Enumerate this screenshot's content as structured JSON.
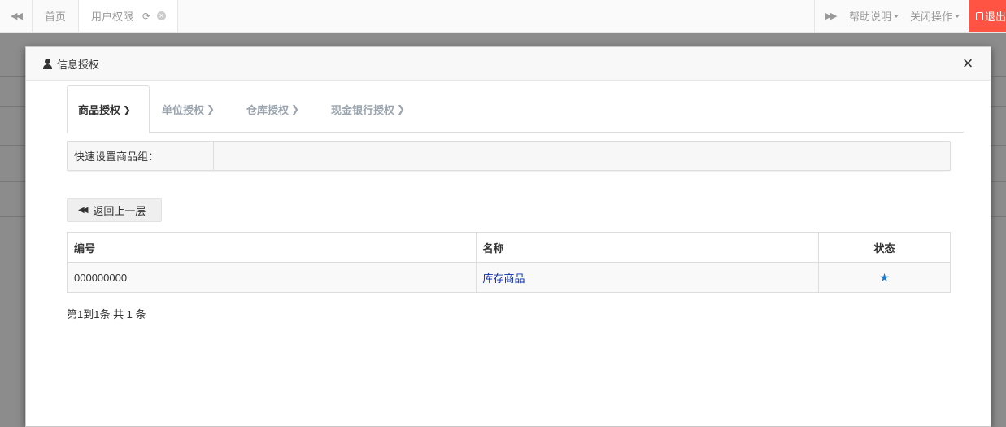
{
  "topbar": {
    "back_icon": "double-left-arrow-icon",
    "tabs": [
      {
        "label": "首页"
      },
      {
        "label": "用户权限",
        "refresh_icon": "refresh-icon",
        "close_icon": "close-circle-icon"
      }
    ],
    "forward_icon": "double-right-arrow-icon",
    "help_label": "帮助说明",
    "close_ops_label": "关闭操作",
    "logout_label": "退出",
    "logout_color": "#ff5444"
  },
  "modal": {
    "title": "信息授权",
    "title_icon": "user-icon",
    "close_symbol": "×",
    "steps": [
      {
        "label": "商品授权",
        "active": true
      },
      {
        "label": "单位授权",
        "active": false
      },
      {
        "label": "仓库授权",
        "active": false
      },
      {
        "label": "现金银行授权",
        "active": false
      }
    ],
    "quick_set_label": "快速设置商品组：",
    "back_button_label": "返回上一层",
    "table": {
      "headers": [
        "编号",
        "名称",
        "状态"
      ],
      "rows": [
        {
          "code": "000000000",
          "name": "库存商品",
          "status": "★"
        }
      ]
    },
    "pager_text": "第1到1条 共 1 条"
  }
}
